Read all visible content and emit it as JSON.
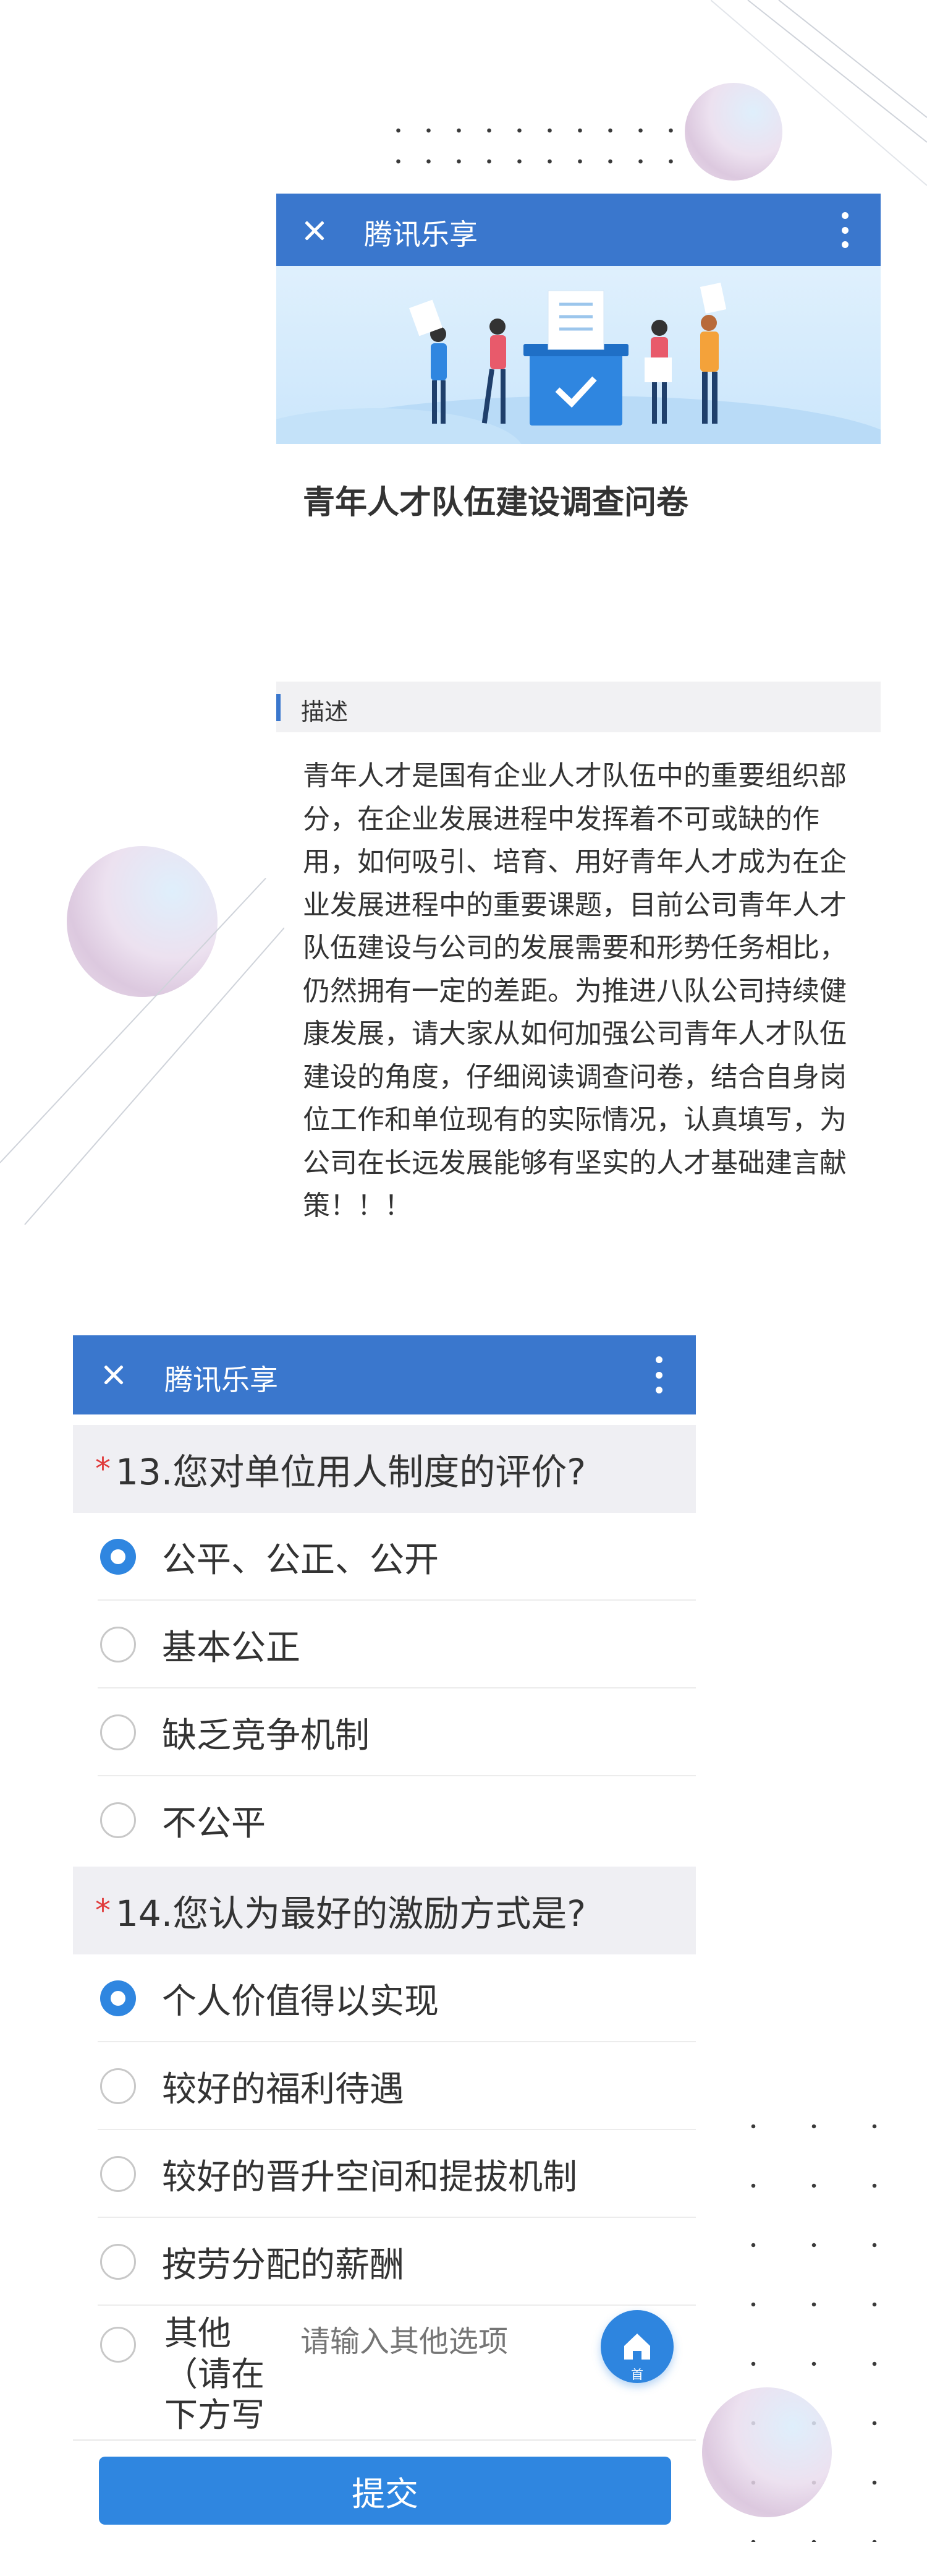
{
  "top_window": {
    "header": {
      "title": "腾讯乐享"
    },
    "survey_title": "青年人才队伍建设调查问卷",
    "description": {
      "label": "描述",
      "text": "青年人才是国有企业人才队伍中的重要组织部分，在企业发展进程中发挥着不可或缺的作用，如何吸引、培育、用好青年人才成为在企业发展进程中的重要课题，目前公司青年人才队伍建设与公司的发展需要和形势任务相比，仍然拥有一定的差距。为推进八队公司持续健康发展，请大家从如何加强公司青年人才队伍建设的角度，仔细阅读调查问卷，结合自身岗位工作和单位现有的实际情况，认真填写，为公司在长远发展能够有坚实的人才基础建言献策！！！"
    }
  },
  "bottom_window": {
    "header": {
      "title": "腾讯乐享"
    },
    "questions": [
      {
        "required_mark": "*",
        "title": "13.您对单位用人制度的评价?",
        "options": [
          "公平、公正、公开",
          "基本公正",
          "缺乏竞争机制",
          "不公平"
        ],
        "selected_index": 0
      },
      {
        "required_mark": "*",
        "title": "14.您认为最好的激励方式是?",
        "options": [
          "个人价值得以实现",
          "较好的福利待遇",
          "较好的晋升空间和提拔机制",
          "按劳分配的薪酬"
        ],
        "selected_index": 0,
        "other": {
          "label_lines": [
            "其他",
            "（请在",
            "下方写"
          ],
          "placeholder": "请输入其他选项"
        }
      }
    ],
    "home_button_label": "首",
    "submit_label": "提交"
  },
  "colors": {
    "header_blue": "#3a77cd",
    "accent_blue": "#2f86e0",
    "required_red": "#e03a3a"
  },
  "icons": [
    "close-icon",
    "more-vertical-icon",
    "home-icon",
    "radio-selected-icon",
    "radio-empty-icon"
  ]
}
